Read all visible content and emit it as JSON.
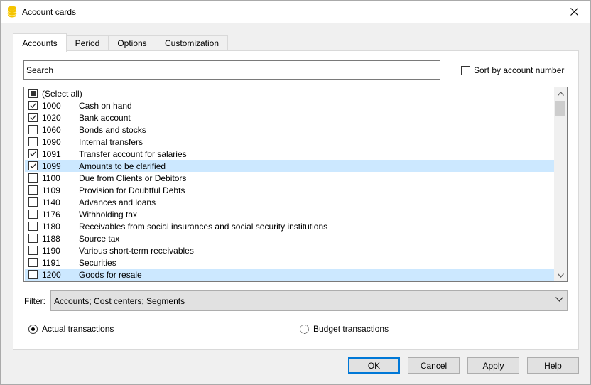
{
  "window": {
    "title": "Account cards",
    "icon": "coins-icon",
    "close_glyph": "✕"
  },
  "tabs": [
    {
      "label": "Accounts",
      "active": true
    },
    {
      "label": "Period",
      "active": false
    },
    {
      "label": "Options",
      "active": false
    },
    {
      "label": "Customization",
      "active": false
    }
  ],
  "search": {
    "value": "Search",
    "placeholder": ""
  },
  "sort": {
    "label": "Sort by account number",
    "checked": false
  },
  "list": {
    "select_all_label": "(Select all)",
    "select_all_state": "indeterminate",
    "rows": [
      {
        "num": "1000",
        "name": "Cash on hand",
        "checked": true,
        "highlighted": false
      },
      {
        "num": "1020",
        "name": "Bank account",
        "checked": true,
        "highlighted": false
      },
      {
        "num": "1060",
        "name": "Bonds and stocks",
        "checked": false,
        "highlighted": false
      },
      {
        "num": "1090",
        "name": "Internal transfers",
        "checked": false,
        "highlighted": false
      },
      {
        "num": "1091",
        "name": "Transfer account for salaries",
        "checked": true,
        "highlighted": false
      },
      {
        "num": "1099",
        "name": "Amounts to be clarified",
        "checked": true,
        "highlighted": true
      },
      {
        "num": "1100",
        "name": "Due from Clients or Debitors",
        "checked": false,
        "highlighted": false
      },
      {
        "num": "1109",
        "name": "Provision for Doubtful Debts",
        "checked": false,
        "highlighted": false
      },
      {
        "num": "1140",
        "name": "Advances and loans",
        "checked": false,
        "highlighted": false
      },
      {
        "num": "1176",
        "name": "Withholding tax",
        "checked": false,
        "highlighted": false
      },
      {
        "num": "1180",
        "name": "Receivables from social insurances and social security institutions",
        "checked": false,
        "highlighted": false
      },
      {
        "num": "1188",
        "name": "Source tax",
        "checked": false,
        "highlighted": false
      },
      {
        "num": "1190",
        "name": "Various short-term receivables",
        "checked": false,
        "highlighted": false
      },
      {
        "num": "1191",
        "name": "Securities",
        "checked": false,
        "highlighted": false
      },
      {
        "num": "1200",
        "name": "Goods for resale",
        "checked": false,
        "highlighted": true
      }
    ]
  },
  "filter": {
    "label": "Filter:",
    "value": "Accounts; Cost centers; Segments"
  },
  "transactions": {
    "actual_label": "Actual transactions",
    "budget_label": "Budget transactions",
    "selected": "actual"
  },
  "buttons": {
    "ok": "OK",
    "cancel": "Cancel",
    "apply": "Apply",
    "help": "Help"
  },
  "colors": {
    "accent": "#0078d7",
    "highlight": "#cce8ff",
    "icon": "#f5c400"
  }
}
